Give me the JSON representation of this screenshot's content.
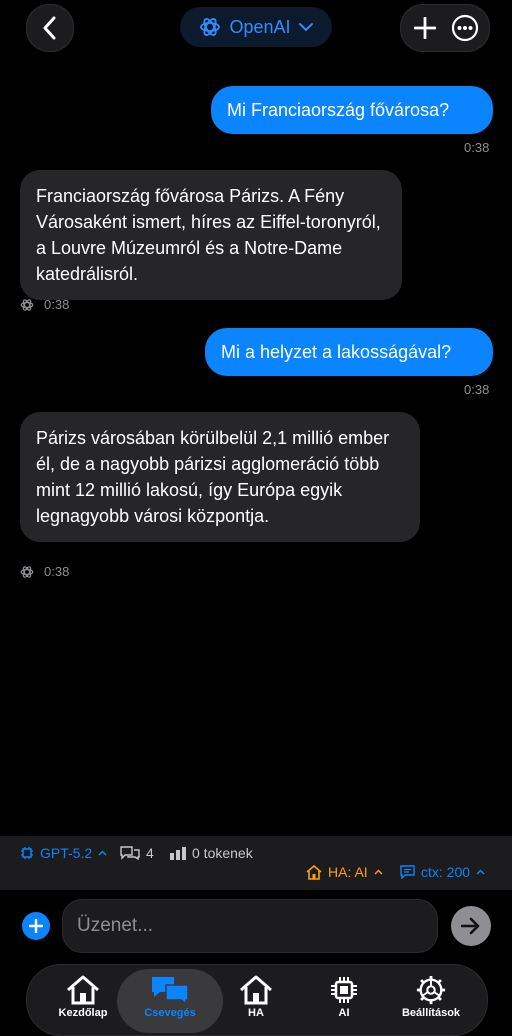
{
  "header": {
    "provider_label": "OpenAI",
    "icons": [
      "chevron-left-icon",
      "openai-icon",
      "chevron-down-icon",
      "plus-icon",
      "more-icon"
    ],
    "accent": "#0a84ff"
  },
  "messages": [
    {
      "role": "user",
      "text": "Mi Franciaország fővárosa?",
      "time": "0:38"
    },
    {
      "role": "ai",
      "text": "Franciaország fővárosa Párizs. A Fény Városaként ismert, híres az Eiffel-toronyról, a Louvre Múzeumról és a Notre-Dame katedrálisról.",
      "time": "0:38"
    },
    {
      "role": "user",
      "text": "Mi a helyzet a lakosságával?",
      "time": "0:38"
    },
    {
      "role": "ai",
      "text": "Párizs városában körülbelül 2,1 millió ember él, de a nagyobb párizsi agglomeráció több mint 12 millió lakosú, így Európa egyik legnagyobb városi központja.",
      "time": "0:38"
    }
  ],
  "status": {
    "model": "GPT-5.2",
    "messages_count": "4",
    "tokens": "0 tokenek",
    "ha": "HA: AI",
    "ctx": "ctx: 200",
    "ha_color": "#ff9f0a",
    "blue_color": "#0a84ff"
  },
  "input": {
    "placeholder": "Üzenet..."
  },
  "tabs": [
    {
      "label": "Kezdőlap",
      "icon": "home-icon",
      "active": false
    },
    {
      "label": "Csevegés",
      "icon": "chat-icon",
      "active": true
    },
    {
      "label": "HA",
      "icon": "home-icon",
      "active": false
    },
    {
      "label": "AI",
      "icon": "chip-icon",
      "active": false
    },
    {
      "label": "Beállítások",
      "icon": "gear-icon",
      "active": false
    }
  ]
}
